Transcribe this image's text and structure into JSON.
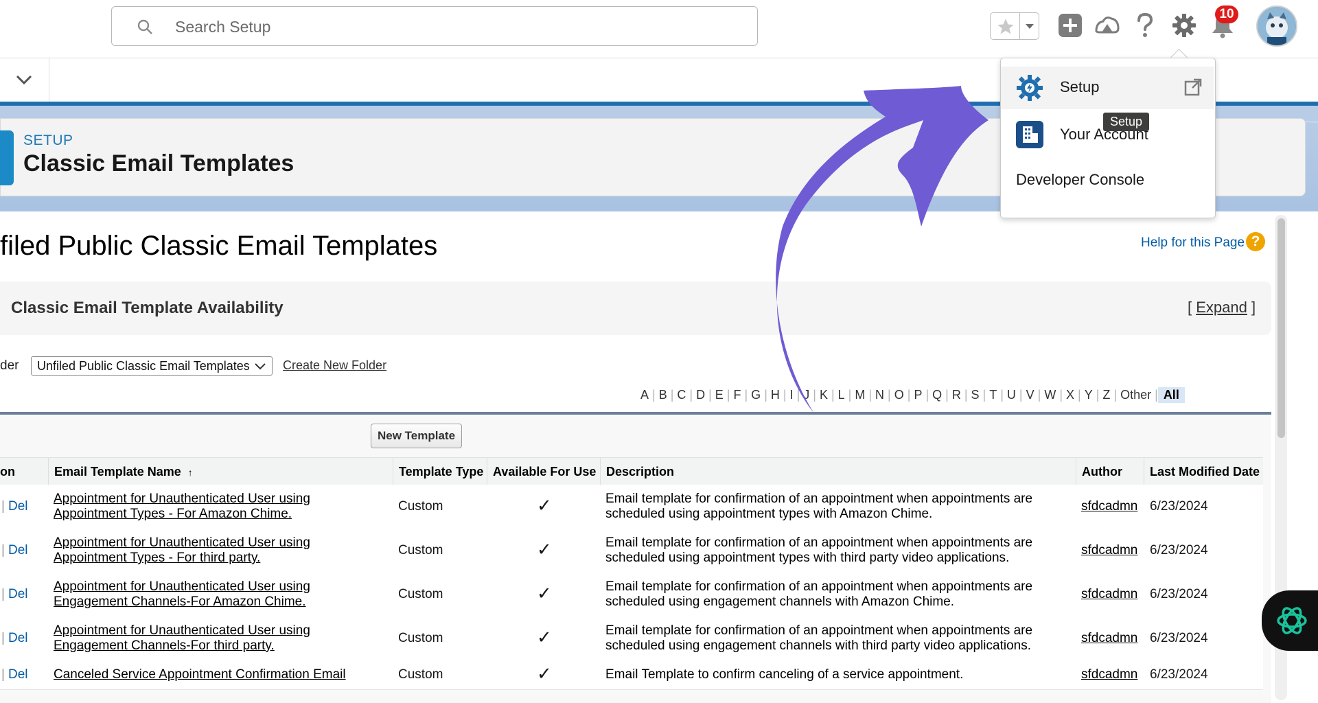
{
  "top_bar": {
    "search_placeholder": "Search Setup",
    "notification_count": "10",
    "icons": [
      "search-icon",
      "star-icon",
      "chevron-down-icon",
      "plus-icon",
      "trailhead-icon",
      "help-icon",
      "gear-icon",
      "bell-icon",
      "avatar"
    ]
  },
  "header": {
    "setup_label": "SETUP",
    "title": "Classic Email Templates"
  },
  "page": {
    "heading": "filed Public Classic Email Templates",
    "help_link": "Help for this Page",
    "help_icon_glyph": "?",
    "availability": {
      "title": "Classic Email Template Availability",
      "open_bracket": "[",
      "expand": "Expand",
      "close_bracket": "]"
    },
    "folder_label": "der",
    "folder_value": "Unfiled Public Classic Email Templates",
    "create_folder": "Create New Folder",
    "alphabet": [
      "A",
      "B",
      "C",
      "D",
      "E",
      "F",
      "G",
      "H",
      "I",
      "J",
      "K",
      "L",
      "M",
      "N",
      "O",
      "P",
      "Q",
      "R",
      "S",
      "T",
      "U",
      "V",
      "W",
      "X",
      "Y",
      "Z",
      "Other",
      "All"
    ]
  },
  "table": {
    "new_template_button": "New Template",
    "headers": {
      "action": "on",
      "name": "Email Template Name",
      "sort_indicator": "↑",
      "type": "Template Type",
      "available": "Available For Use",
      "description": "Description",
      "author": "Author",
      "modified": "Last Modified Date"
    },
    "action_del": "Del",
    "action_pipe": "|",
    "check_glyph": "✓",
    "rows": [
      {
        "name1": "Appointment for Unauthenticated User using",
        "name2": "Appointment Types - For Amazon Chime.",
        "type": "Custom",
        "available": true,
        "desc1": "Email template for confirmation of an appointment when appointments are",
        "desc2": "scheduled using appointment types with Amazon Chime.",
        "author": "sfdcadmn",
        "modified": "6/23/2024"
      },
      {
        "name1": "Appointment for Unauthenticated User using",
        "name2": "Appointment Types - For third party.",
        "type": "Custom",
        "available": true,
        "desc1": "Email template for confirmation of an appointment when appointments are",
        "desc2": "scheduled using appointment types with third party video applications.",
        "author": "sfdcadmn",
        "modified": "6/23/2024"
      },
      {
        "name1": "Appointment for Unauthenticated User using",
        "name2": "Engagement Channels-For Amazon Chime.",
        "type": "Custom",
        "available": true,
        "desc1": "Email template for confirmation of an appointment when appointments are",
        "desc2": "scheduled using engagement channels with Amazon Chime.",
        "author": "sfdcadmn",
        "modified": "6/23/2024"
      },
      {
        "name1": "Appointment for Unauthenticated User using",
        "name2": "Engagement Channels-For third party.",
        "type": "Custom",
        "available": true,
        "desc1": "Email template for confirmation of an appointment when appointments are",
        "desc2": "scheduled using engagement channels with third party video applications.",
        "author": "sfdcadmn",
        "modified": "6/23/2024"
      },
      {
        "name1": "Canceled Service Appointment Confirmation Email",
        "name2": "",
        "type": "Custom",
        "available": true,
        "desc1": "Email Template to confirm canceling of a service appointment.",
        "desc2": "",
        "author": "sfdcadmn",
        "modified": "6/23/2024"
      }
    ]
  },
  "setup_menu": {
    "items": [
      {
        "label": "Setup",
        "icon": "setup-gear-icon"
      },
      {
        "label": "Your Account",
        "icon": "building-icon"
      },
      {
        "label": "Developer Console",
        "icon": ""
      }
    ],
    "tooltip": "Setup"
  },
  "colors": {
    "accent_blue": "#1f6eb0",
    "link_blue": "#015ba7",
    "arrow_purple": "#6f5bd3",
    "badge_red": "#e01919"
  }
}
